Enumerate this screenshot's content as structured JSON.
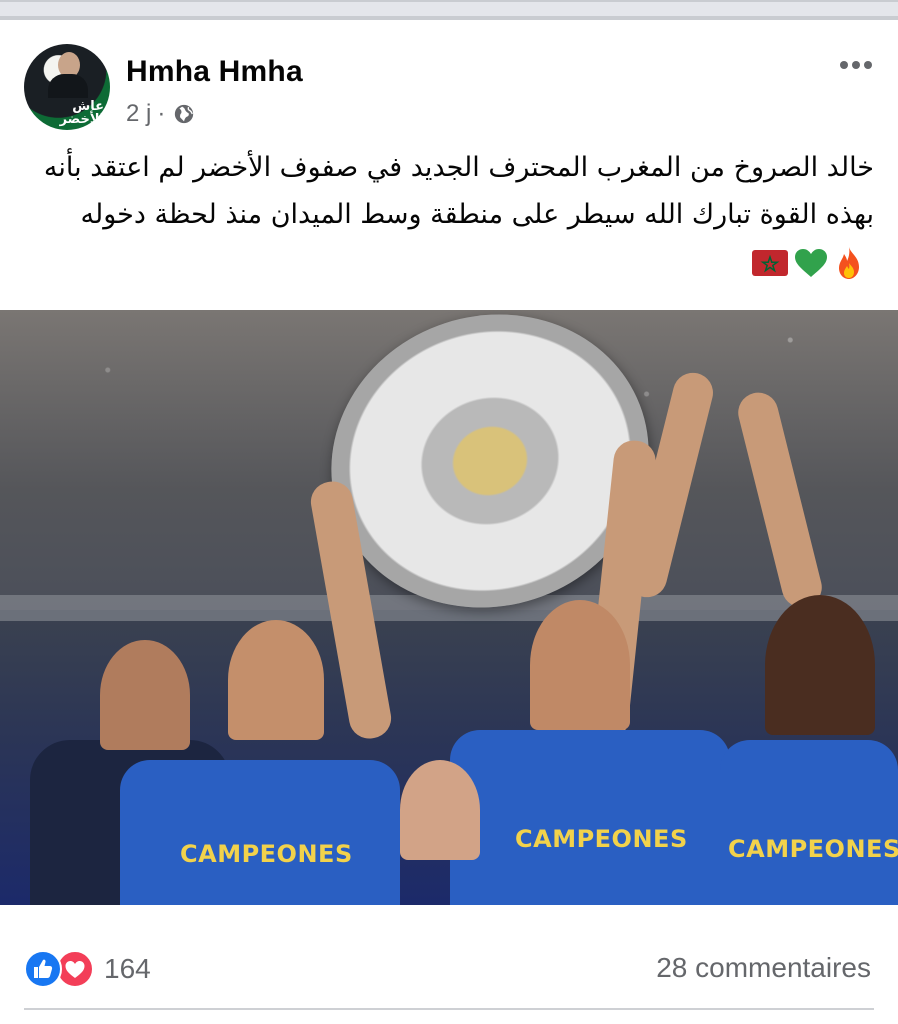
{
  "post": {
    "author": "Hmha Hmha",
    "time": "2 j",
    "separator": "·",
    "privacy_icon": "globe-icon",
    "avatar_text": "عاش الأخضر",
    "text": "خالد الصروخ من المغرب المحترف الجديد في صفوف الأخضر لم اعتقد بأنه بهذه القوة تبارك الله سيطر على منطقة وسط الميدان منذ لحظة دخوله",
    "emojis": [
      "flame-icon",
      "green-heart-icon",
      "morocco-flag-icon"
    ],
    "photo_text": {
      "left_jersey": "CAMPEONES",
      "center_jersey": "CAMPEONES",
      "right_jersey": "CAMPEONES"
    }
  },
  "engagement": {
    "reaction_count": "164",
    "comments": "28 commentaires",
    "reaction_icons": [
      "like-icon",
      "love-icon"
    ]
  },
  "colors": {
    "like": "#1877f2",
    "love": "#f33e58",
    "secondary_text": "#65676b",
    "green_heart": "#31a24c"
  }
}
